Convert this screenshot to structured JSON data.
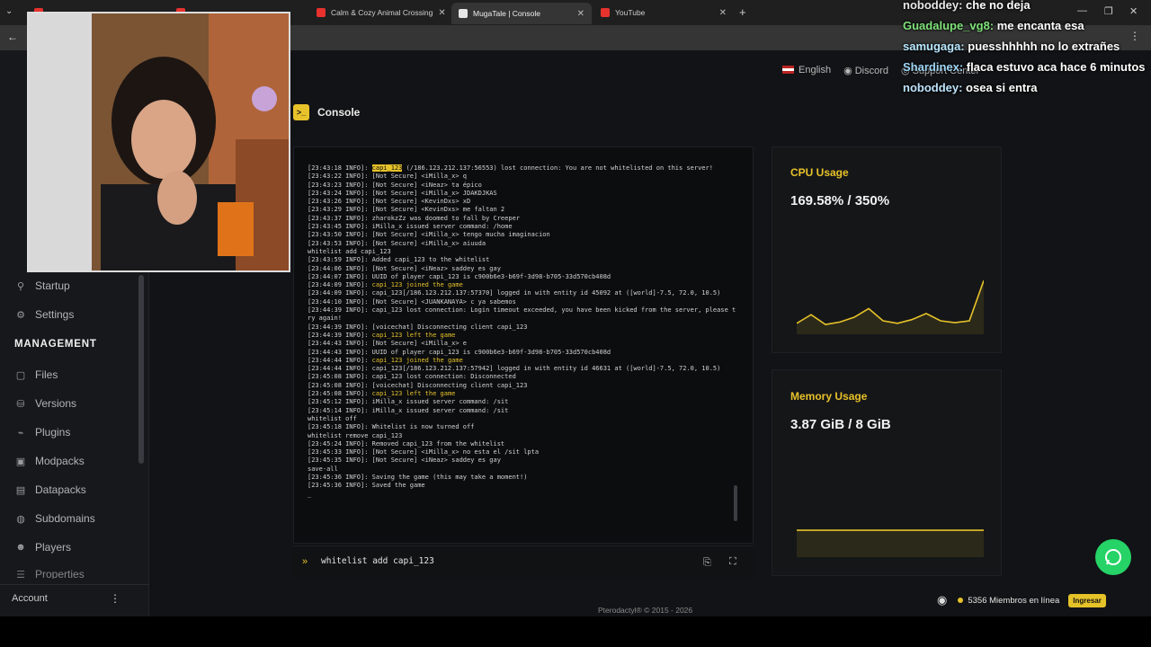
{
  "browser": {
    "tabs": [
      {
        "label": "...",
        "color": "#e7322e"
      },
      {
        "label": "...",
        "color": "#e7322e"
      },
      {
        "label": "Calm & Cozy Animal Crossing",
        "color": "#e7322e"
      },
      {
        "label": "MugaTale | Console",
        "color": "#f0f0f0"
      },
      {
        "label": "YouTube",
        "color": "#e7322e"
      }
    ],
    "new_tab": "+"
  },
  "topnav": {
    "language": "English",
    "discord": "Discord",
    "support": "Support Center"
  },
  "sidebar": {
    "items_top": [
      {
        "label": "Startup",
        "icon": "rocket-icon"
      },
      {
        "label": "Settings",
        "icon": "gear-icon"
      }
    ],
    "management_heading": "MANAGEMENT",
    "items": [
      {
        "label": "Files",
        "icon": "folder-icon"
      },
      {
        "label": "Versions",
        "icon": "versions-icon"
      },
      {
        "label": "Plugins",
        "icon": "plug-icon"
      },
      {
        "label": "Modpacks",
        "icon": "box-icon"
      },
      {
        "label": "Datapacks",
        "icon": "database-icon"
      },
      {
        "label": "Subdomains",
        "icon": "globe-icon"
      },
      {
        "label": "Players",
        "icon": "users-icon"
      },
      {
        "label": "Properties",
        "icon": "sliders-icon"
      }
    ],
    "account": "Account"
  },
  "console": {
    "title": "Console",
    "command": "whitelist add capi_123",
    "lines": [
      {
        "t": "[23:43:18 INFO]: ",
        "hl": "capi_123",
        "r": " (/186.123.212.137:56553) lost connection: You are not whitelisted on this server!"
      },
      {
        "t": "[23:43:22 INFO]: [Not Secure] <iMilla_x> q"
      },
      {
        "t": "[23:43:23 INFO]: [Not Secure] <iNeaz> ta épico"
      },
      {
        "t": "[23:43:24 INFO]: [Not Secure] <iMilla_x> JDAKDJKAS"
      },
      {
        "t": "[23:43:26 INFO]: [Not Secure] <KevinDxs> xD"
      },
      {
        "t": "[23:43:29 INFO]: [Not Secure] <KevinDxs> me faltan 2"
      },
      {
        "t": "[23:43:37 INFO]: zharokzZz was doomed to fall by Creeper"
      },
      {
        "t": "[23:43:45 INFO]: iMilla_x issued server command: /home"
      },
      {
        "t": "[23:43:50 INFO]: [Not Secure] <iMilla_x> tengo mucha imaginacion"
      },
      {
        "t": "[23:43:53 INFO]: [Not Secure] <iMilla_x> aiuuda"
      },
      {
        "t": "whitelist add capi_123"
      },
      {
        "t": "[23:43:59 INFO]: Added capi_123 to the whitelist"
      },
      {
        "t": "[23:44:06 INFO]: [Not Secure] <iNeaz> saddey es gay"
      },
      {
        "t": "[23:44:07 INFO]: UUID of player capi_123 is c900b6e3-b69f-3d98-b705-33d570cb408d"
      },
      {
        "t": "[23:44:09 INFO]: ",
        "y": "capi_123 joined the game"
      },
      {
        "t": "[23:44:09 INFO]: capi_123[/186.123.212.137:57370] logged in with entity id 45092 at ([world]-7.5, 72.0, 10.5)"
      },
      {
        "t": "[23:44:10 INFO]: [Not Secure] <JUANKANAYA> c ya sabemos"
      },
      {
        "t": "[23:44:39 INFO]: capi_123 lost connection: Login timeout exceeded, you have been kicked from the server, please try again!"
      },
      {
        "t": "[23:44:39 INFO]: [voicechat] Disconnecting client capi_123"
      },
      {
        "t": "[23:44:39 INFO]: ",
        "y": "capi_123 left the game"
      },
      {
        "t": "[23:44:43 INFO]: [Not Secure] <iMilla_x> e"
      },
      {
        "t": "[23:44:43 INFO]: UUID of player capi_123 is c900b6e3-b69f-3d98-b705-33d570cb408d"
      },
      {
        "t": "[23:44:44 INFO]: ",
        "y": "capi_123 joined the game"
      },
      {
        "t": "[23:44:44 INFO]: capi_123[/186.123.212.137:57942] logged in with entity id 46631 at ([world]-7.5, 72.0, 10.5)"
      },
      {
        "t": "[23:45:08 INFO]: capi_123 lost connection: Disconnected"
      },
      {
        "t": "[23:45:08 INFO]: [voicechat] Disconnecting client capi_123"
      },
      {
        "t": "[23:45:08 INFO]: ",
        "y": "capi_123 left the game"
      },
      {
        "t": "[23:45:12 INFO]: iMilla_x issued server command: /sit"
      },
      {
        "t": "[23:45:14 INFO]: iMilla_x issued server command: /sit"
      },
      {
        "t": "whitelist off"
      },
      {
        "t": "[23:45:18 INFO]: Whitelist is now turned off"
      },
      {
        "t": "whitelist remove capi_123"
      },
      {
        "t": "[23:45:24 INFO]: Removed capi_123 from the whitelist"
      },
      {
        "t": "[23:45:33 INFO]: [Not Secure] <iMilla_x> no esta el /sit lpta"
      },
      {
        "t": "[23:45:35 INFO]: [Not Secure] <iNeaz> saddey es gay"
      },
      {
        "t": "save-all"
      },
      {
        "t": "[23:45:36 INFO]: Saving the game (this may take a moment!)"
      },
      {
        "t": "[23:45:36 INFO]: Saved the game"
      },
      {
        "t": "_"
      }
    ]
  },
  "cpu": {
    "label": "CPU Usage",
    "value": "169.58% / 350%",
    "series": [
      0.18,
      0.32,
      0.16,
      0.2,
      0.28,
      0.42,
      0.22,
      0.18,
      0.24,
      0.34,
      0.22,
      0.19,
      0.22,
      0.88
    ]
  },
  "memory": {
    "label": "Memory Usage",
    "value": "3.87 GiB / 8 GiB",
    "fill": 0.44
  },
  "chat": [
    {
      "user": "noboddey:",
      "msg": "che no deja",
      "color": "#e8e8e8"
    },
    {
      "user": "Guadalupe_vg8:",
      "msg": "me encanta esa",
      "color": "#7fe37a"
    },
    {
      "user": "samugaga:",
      "msg": "puesshhhhh no lo extrañes",
      "color": "#b8e8ff"
    },
    {
      "user": "Shardinex:",
      "msg": "flaca estuvo aca hace 6 minutos",
      "color": "#9fd6f5"
    },
    {
      "user": "noboddey:",
      "msg": "osea si entra",
      "color": "#bde5ff"
    }
  ],
  "footer": {
    "copyright": "Pterodactyl® © 2015 - 2026",
    "members": "5356 Miembros en línea",
    "join": "Ingresar"
  }
}
